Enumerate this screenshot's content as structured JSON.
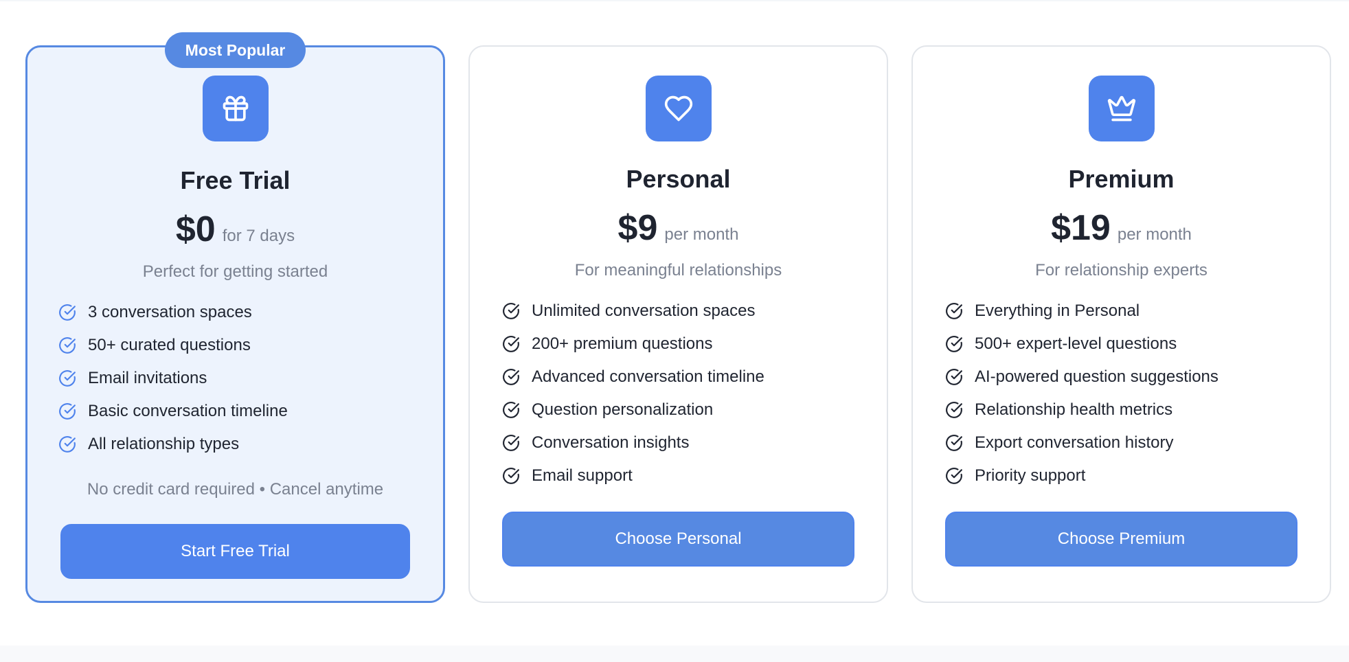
{
  "theme": {
    "accent": "#4f83ec",
    "featured_bg": "#edf3fd",
    "text_dark": "#1f2430",
    "text_muted": "#7a8190"
  },
  "plans": [
    {
      "badge": "Most Popular",
      "icon": "gift-icon",
      "name": "Free Trial",
      "price": "$0",
      "period": "for 7 days",
      "tagline": "Perfect for getting started",
      "features": [
        "3 conversation spaces",
        "50+ curated questions",
        "Email invitations",
        "Basic conversation timeline",
        "All relationship types"
      ],
      "note": "No credit card required • Cancel anytime",
      "cta": "Start Free Trial"
    },
    {
      "icon": "heart-icon",
      "name": "Personal",
      "price": "$9",
      "period": "per month",
      "tagline": "For meaningful relationships",
      "features": [
        "Unlimited conversation spaces",
        "200+ premium questions",
        "Advanced conversation timeline",
        "Question personalization",
        "Conversation insights",
        "Email support"
      ],
      "cta": "Choose Personal"
    },
    {
      "icon": "crown-icon",
      "name": "Premium",
      "price": "$19",
      "period": "per month",
      "tagline": "For relationship experts",
      "features": [
        "Everything in Personal",
        "500+ expert-level questions",
        "AI-powered question suggestions",
        "Relationship health metrics",
        "Export conversation history",
        "Priority support"
      ],
      "cta": "Choose Premium"
    }
  ]
}
